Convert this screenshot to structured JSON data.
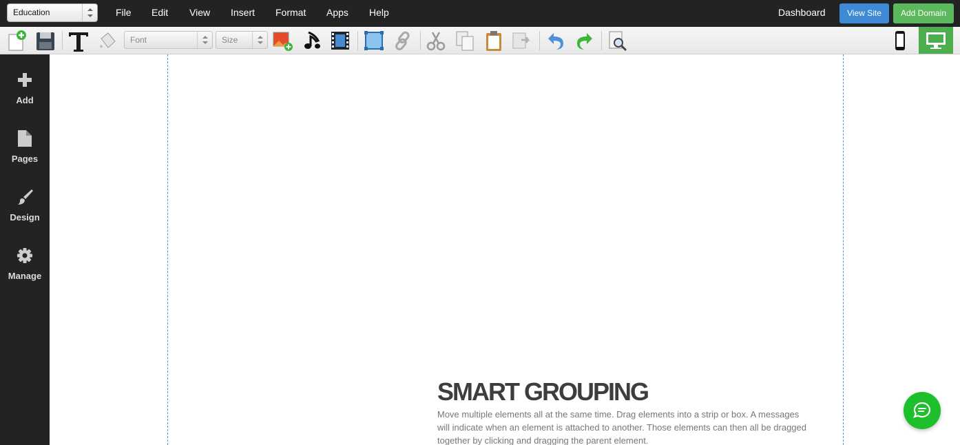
{
  "menubar": {
    "site_select": "Education",
    "items": [
      "File",
      "Edit",
      "View",
      "Insert",
      "Format",
      "Apps",
      "Help"
    ],
    "dashboard": "Dashboard",
    "view_site": "View Site",
    "add_domain": "Add Domain"
  },
  "toolbar": {
    "font_placeholder": "Font",
    "size_placeholder": "Size"
  },
  "sidebar": {
    "items": [
      {
        "label": "Add",
        "icon": "plus-icon"
      },
      {
        "label": "Pages",
        "icon": "page-icon"
      },
      {
        "label": "Design",
        "icon": "brush-icon"
      },
      {
        "label": "Manage",
        "icon": "gear-icon"
      }
    ]
  },
  "content": {
    "headline": "SMART GROUPING",
    "body": "Move multiple elements all at the same time. Drag elements into a strip or box. A messages will indicate when an element is attached to another. Those elements can then all be dragged together by clicking and dragging the parent element."
  },
  "colors": {
    "menubar_bg": "#232323",
    "view_site": "#3e8ad6",
    "add_domain": "#5cb85c",
    "chat": "#1ebf2d",
    "guide": "#5b8fd8"
  }
}
